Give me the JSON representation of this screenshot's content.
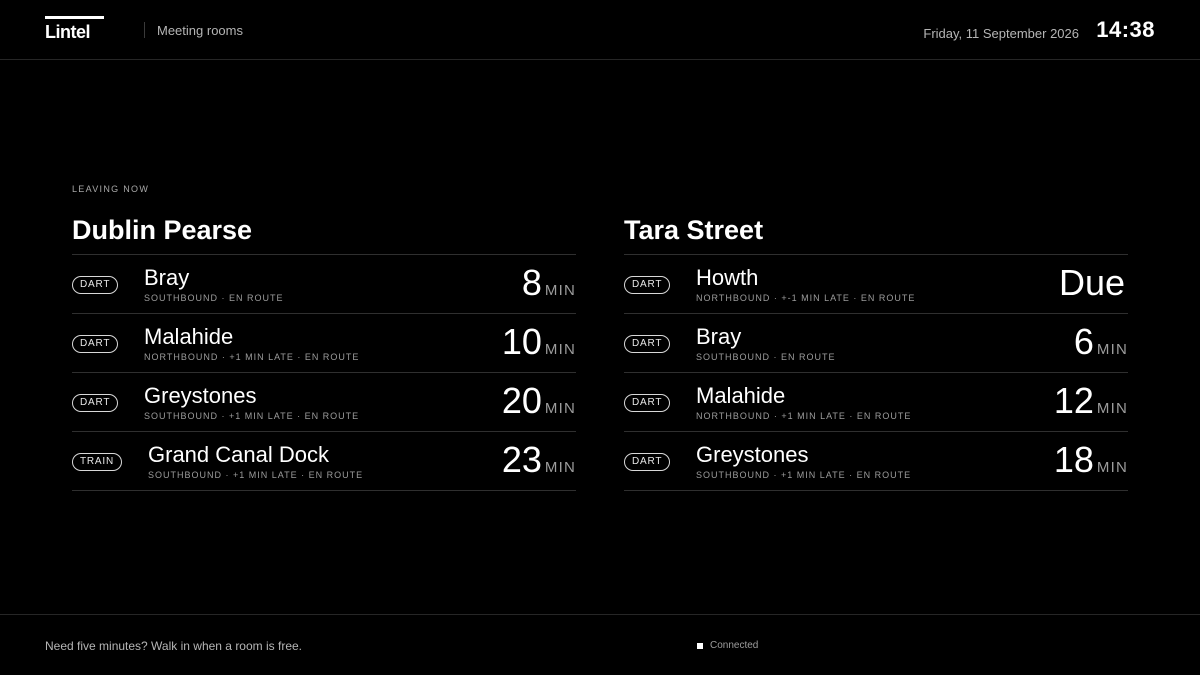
{
  "header": {
    "logo": "Lintel",
    "section": "Meeting rooms",
    "date": "Friday, 11 September 2026",
    "time": "14:38"
  },
  "eyebrow": "LEAVING NOW",
  "stations": [
    {
      "name": "Dublin Pearse",
      "departures": [
        {
          "type": "DART",
          "destination": "Bray",
          "meta": "SOUTHBOUND · EN ROUTE",
          "due": "8",
          "unit": "MIN"
        },
        {
          "type": "DART",
          "destination": "Malahide",
          "meta": "NORTHBOUND · +1 MIN LATE · EN ROUTE",
          "due": "10",
          "unit": "MIN"
        },
        {
          "type": "DART",
          "destination": "Greystones",
          "meta": "SOUTHBOUND · +1 MIN LATE · EN ROUTE",
          "due": "20",
          "unit": "MIN"
        },
        {
          "type": "TRAIN",
          "destination": "Grand Canal Dock",
          "meta": "SOUTHBOUND · +1 MIN LATE · EN ROUTE",
          "due": "23",
          "unit": "MIN"
        }
      ]
    },
    {
      "name": "Tara Street",
      "departures": [
        {
          "type": "DART",
          "destination": "Howth",
          "meta": "NORTHBOUND · +-1 MIN LATE · EN ROUTE",
          "due": "Due",
          "unit": ""
        },
        {
          "type": "DART",
          "destination": "Bray",
          "meta": "SOUTHBOUND · EN ROUTE",
          "due": "6",
          "unit": "MIN"
        },
        {
          "type": "DART",
          "destination": "Malahide",
          "meta": "NORTHBOUND · +1 MIN LATE · EN ROUTE",
          "due": "12",
          "unit": "MIN"
        },
        {
          "type": "DART",
          "destination": "Greystones",
          "meta": "SOUTHBOUND · +1 MIN LATE · EN ROUTE",
          "due": "18",
          "unit": "MIN"
        }
      ]
    }
  ],
  "footer": {
    "tagline": "Need five minutes? Walk in when a room is free.",
    "status": "Connected"
  }
}
